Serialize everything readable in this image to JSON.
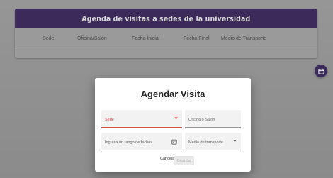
{
  "header": {
    "title": "Agenda de visitas a sedes de la universidad",
    "brand_color": "#3b2a5a"
  },
  "table": {
    "columns": [
      "Sede",
      "Oficina/Salón",
      "Fecha Inicial",
      "Fecha Final",
      "Medio de Transporte"
    ]
  },
  "fab": {
    "icon": "calendar-add-icon"
  },
  "dialog": {
    "title": "Agendar Visita",
    "sede": {
      "label": "Sede",
      "state": "error",
      "error_color": "#e24a4a",
      "icon": "chevron-down-icon"
    },
    "oficina": {
      "placeholder": "Oficina o Salón"
    },
    "fechas": {
      "placeholder": "Ingresa un rango de fechas",
      "icon": "calendar-icon"
    },
    "transporte": {
      "placeholder": "Medio de transporte",
      "icon": "chevron-down-icon"
    },
    "cancel_label": "Cancelar",
    "save_label": "Guardar",
    "save_disabled": true
  }
}
